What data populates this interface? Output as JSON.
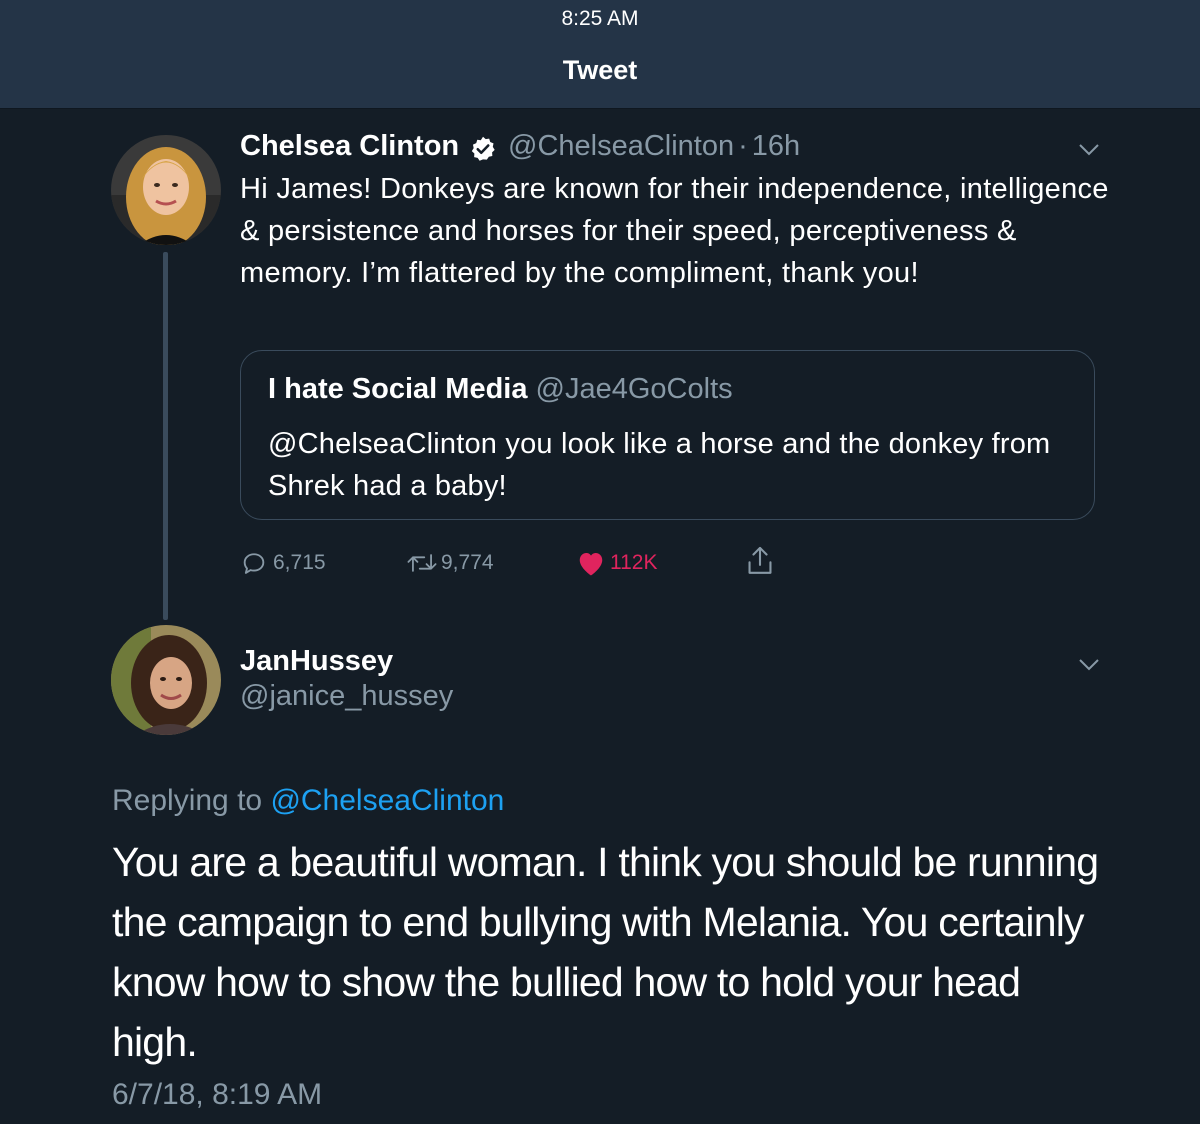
{
  "status_bar": {
    "time": "8:25 AM"
  },
  "header": {
    "title": "Tweet"
  },
  "main_tweet": {
    "author_name": "Chelsea Clinton",
    "handle": "@ChelseaClinton",
    "separator": "·",
    "age": "16h",
    "text": "Hi James! Donkeys are known for their independence, intelligence & persistence and horses for their speed, perceptiveness & memory. I’m flattered by the compliment, thank you!",
    "quoted": {
      "author_name": "I hate Social Media",
      "handle": "@Jae4GoColts",
      "text": "@ChelseaClinton you look like a horse and the donkey from Shrek had a baby!"
    },
    "actions": {
      "replies": "6,715",
      "retweets": "9,774",
      "likes": "112K"
    }
  },
  "reply_tweet": {
    "author_name": "JanHussey",
    "handle": "@janice_hussey",
    "replying_prefix": "Replying to",
    "replying_to": "@ChelseaClinton",
    "text": "You are a beautiful woman. I think you should be running the campaign to end bullying with Melania. You certainly know how to show the bullied how to hold your head high.",
    "timestamp": "6/7/18, 8:19 AM"
  },
  "colors": {
    "background": "#141d26",
    "header_bg": "#243447",
    "muted": "#8899a6",
    "link": "#1da1f2",
    "like": "#e0245e",
    "border": "#3a4b5c"
  },
  "icons": [
    "verified-badge-icon",
    "chevron-down-icon",
    "reply-icon",
    "retweet-icon",
    "heart-icon",
    "share-icon"
  ]
}
